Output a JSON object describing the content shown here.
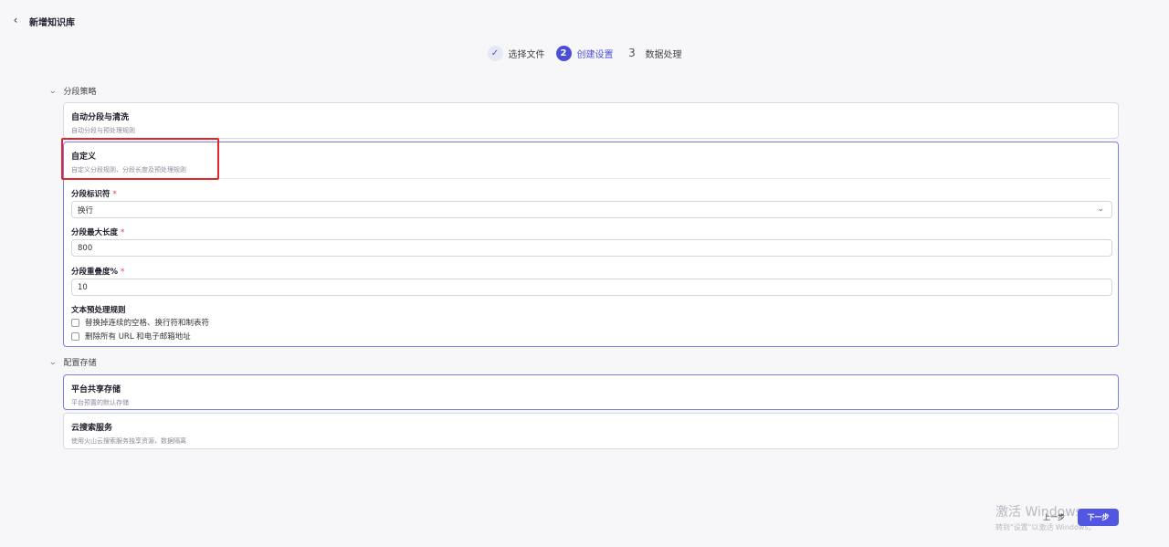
{
  "header": {
    "back_icon": "chevron-left-icon",
    "title": "新增知识库"
  },
  "steps": [
    {
      "number": "✓",
      "label": "选择文件",
      "state": "done"
    },
    {
      "number": "2",
      "label": "创建设置",
      "state": "active"
    },
    {
      "number": "3",
      "label": "数据处理",
      "state": "todo"
    }
  ],
  "segmentation": {
    "section_title": "分段策略",
    "auto": {
      "title": "自动分段与清洗",
      "subtitle": "自动分段与预处理规则"
    },
    "custom": {
      "title": "自定义",
      "subtitle": "自定义分段规则、分段长度及预处理规则",
      "identifier_label": "分段标识符",
      "identifier_value": "换行",
      "max_length_label": "分段最大长度",
      "max_length_value": "800",
      "overlap_label": "分段重叠度%",
      "overlap_value": "10",
      "preprocess_label": "文本预处理规则",
      "rule_1": "替换掉连续的空格、换行符和制表符",
      "rule_2": "删除所有 URL 和电子邮箱地址"
    },
    "required_mark": "*"
  },
  "storage": {
    "section_title": "配置存储",
    "shared": {
      "title": "平台共享存储",
      "subtitle": "平台预置的默认存储"
    },
    "cloud": {
      "title": "云搜索服务",
      "subtitle": "使用火山云搜索服务独享资源，数据隔离"
    }
  },
  "footer": {
    "prev_label": "上一步",
    "next_label": "下一步"
  },
  "watermark": {
    "title": "激活 Windows",
    "subtitle": "转到\"设置\"以激活 Windows。"
  },
  "colors": {
    "accent": "#4b4fd8",
    "highlight": "#e02828",
    "required": "#e23b3b"
  }
}
